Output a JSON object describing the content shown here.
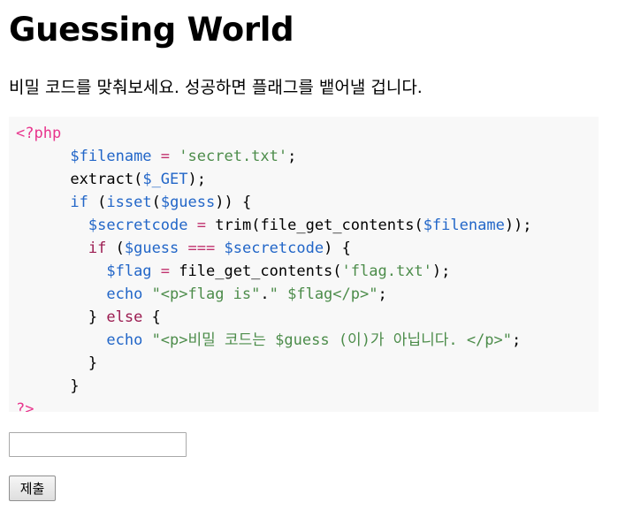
{
  "page": {
    "title": "Guessing World",
    "intro": "비밀 코드를 맞춰보세요. 성공하면 플래그를 뱉어낼 겁니다."
  },
  "code": {
    "open_tag": "<?php",
    "close_tag": "?>",
    "var_filename": "$filename",
    "assign": "=",
    "str_secret": "'secret.txt'",
    "semicolon": ";",
    "fn_extract": "extract",
    "var_get": "$_GET",
    "kw_if": "if",
    "fn_isset": "isset",
    "var_guess": "$guess",
    "var_secretcode": "$secretcode",
    "fn_trim": "trim",
    "fn_file_get_contents": "file_get_contents",
    "op_identical": "===",
    "var_flag": "$flag",
    "str_flag_file": "'flag.txt'",
    "kw_echo": "echo",
    "str_flag_open": "\"<p>flag is\"",
    "str_dot": ".",
    "str_flag_close": "\" $flag</p>\"",
    "kw_else": "else",
    "str_wrong": "\"<p>비밀 코드는 $guess (이)가 아닙니다. </p>\""
  },
  "form": {
    "guess_value": "",
    "submit_label": "제출"
  }
}
